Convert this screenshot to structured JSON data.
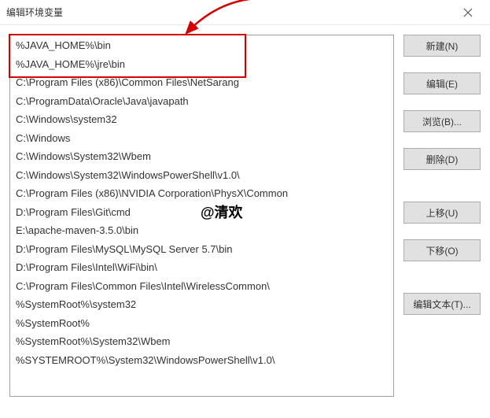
{
  "window": {
    "title": "编辑环境变量"
  },
  "list": {
    "items": [
      "%JAVA_HOME%\\bin",
      "%JAVA_HOME%\\jre\\bin",
      "C:\\Program Files (x86)\\Common Files\\NetSarang",
      "C:\\ProgramData\\Oracle\\Java\\javapath",
      "C:\\Windows\\system32",
      "C:\\Windows",
      "C:\\Windows\\System32\\Wbem",
      "C:\\Windows\\System32\\WindowsPowerShell\\v1.0\\",
      "C:\\Program Files (x86)\\NVIDIA Corporation\\PhysX\\Common",
      "D:\\Program Files\\Git\\cmd",
      "E:\\apache-maven-3.5.0\\bin",
      "D:\\Program Files\\MySQL\\MySQL Server 5.7\\bin",
      "D:\\Program Files\\Intel\\WiFi\\bin\\",
      "C:\\Program Files\\Common Files\\Intel\\WirelessCommon\\",
      "%SystemRoot%\\system32",
      "%SystemRoot%",
      "%SystemRoot%\\System32\\Wbem",
      "%SYSTEMROOT%\\System32\\WindowsPowerShell\\v1.0\\"
    ]
  },
  "buttons": {
    "new": "新建(N)",
    "edit": "编辑(E)",
    "browse": "浏览(B)...",
    "delete": "删除(D)",
    "moveup": "上移(U)",
    "movedown": "下移(O)",
    "edittext": "编辑文本(T)..."
  },
  "watermark": "@清欢"
}
